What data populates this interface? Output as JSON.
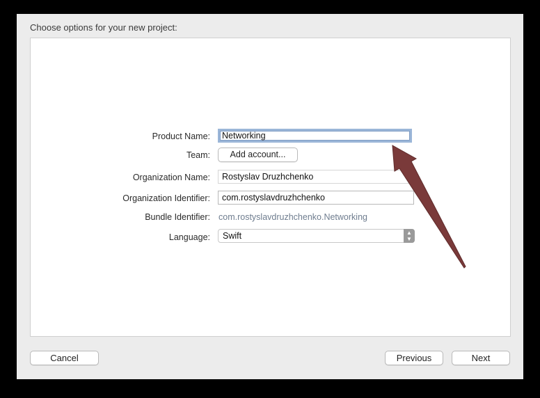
{
  "dialog": {
    "title": "Choose options for your new project:"
  },
  "form": {
    "product_name_label": "Product Name:",
    "product_name_value": "Networking",
    "team_label": "Team:",
    "add_account_label": "Add account...",
    "org_name_label": "Organization Name:",
    "org_name_value": "Rostyslav Druzhchenko",
    "org_id_label": "Organization Identifier:",
    "org_id_value": "com.rostyslavdruzhchenko",
    "bundle_id_label": "Bundle Identifier:",
    "bundle_id_value": "com.rostyslavdruzhchenko.Networking",
    "language_label": "Language:",
    "language_value": "Swift",
    "stepper_up": "▲",
    "stepper_down": "▼"
  },
  "footer": {
    "cancel_label": "Cancel",
    "previous_label": "Previous",
    "next_label": "Next"
  },
  "colors": {
    "annotation_arrow": "#7a3a3a",
    "focus_ring": "#9bb6d8"
  }
}
